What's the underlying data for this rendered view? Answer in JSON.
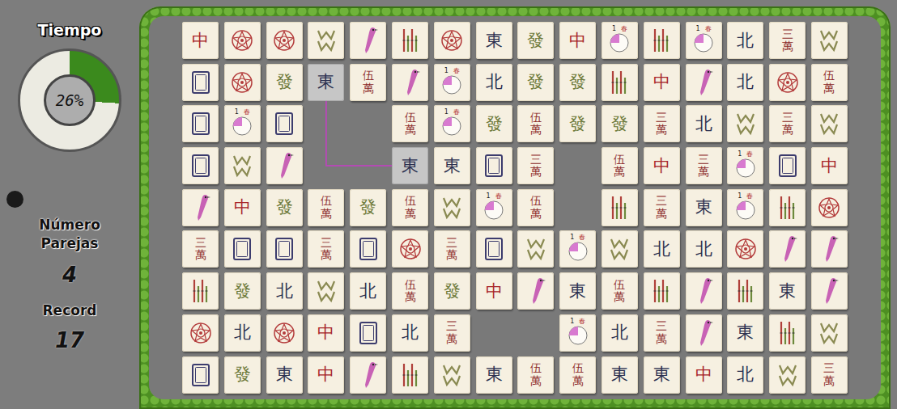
{
  "sidebar": {
    "timer": {
      "label": "Tiempo",
      "reading": "26%",
      "level": 0.26
    },
    "pairs": {
      "label": "Número Parejas",
      "value": "4"
    },
    "record": {
      "label": "Record",
      "value": "17"
    }
  },
  "board": {
    "rows": [
      [
        {
          "kind": "red",
          "text": "中",
          "selected": false
        },
        {
          "kind": "flower",
          "selected": false
        },
        {
          "kind": "flower",
          "selected": false
        },
        {
          "kind": "wm",
          "selected": false
        },
        {
          "kind": "bird",
          "selected": false
        },
        {
          "kind": "bamboo",
          "selected": false
        },
        {
          "kind": "flower",
          "selected": false
        },
        {
          "kind": "wind",
          "text": "東",
          "selected": false
        },
        {
          "kind": "green",
          "text": "發",
          "selected": false
        },
        {
          "kind": "red",
          "text": "中",
          "selected": false
        },
        {
          "kind": "season",
          "number": "1",
          "text": "春",
          "selected": false
        },
        {
          "kind": "bamboo",
          "selected": false
        },
        {
          "kind": "season",
          "number": "1",
          "text": "春",
          "selected": false
        },
        {
          "kind": "wind",
          "text": "北",
          "selected": false
        },
        {
          "kind": "wan",
          "text": "三萬",
          "selected": false
        },
        {
          "kind": "wm",
          "selected": false
        }
      ],
      [
        {
          "kind": "white",
          "selected": false
        },
        {
          "kind": "flower",
          "selected": false
        },
        {
          "kind": "green",
          "text": "發",
          "selected": false
        },
        {
          "kind": "wind",
          "text": "東",
          "selected": true
        },
        {
          "kind": "wan",
          "text": "伍萬",
          "selected": false
        },
        {
          "kind": "bird",
          "selected": false
        },
        {
          "kind": "season",
          "number": "1",
          "text": "春",
          "selected": false
        },
        {
          "kind": "wind",
          "text": "北",
          "selected": false
        },
        {
          "kind": "green",
          "text": "發",
          "selected": false
        },
        {
          "kind": "green",
          "text": "發",
          "selected": false
        },
        {
          "kind": "bamboo",
          "selected": false
        },
        {
          "kind": "red",
          "text": "中",
          "selected": false
        },
        {
          "kind": "bird",
          "selected": false
        },
        {
          "kind": "wind",
          "text": "北",
          "selected": false
        },
        {
          "kind": "flower",
          "selected": false
        },
        {
          "kind": "wan",
          "text": "伍萬",
          "selected": false
        }
      ],
      [
        {
          "kind": "white",
          "selected": false
        },
        {
          "kind": "season",
          "number": "1",
          "text": "春",
          "selected": false
        },
        {
          "kind": "white",
          "selected": false
        },
        {
          "kind": "empty",
          "selected": false
        },
        {
          "kind": "empty",
          "selected": false
        },
        {
          "kind": "wan",
          "text": "伍萬",
          "selected": false
        },
        {
          "kind": "season",
          "number": "1",
          "text": "春",
          "selected": false
        },
        {
          "kind": "green",
          "text": "發",
          "selected": false
        },
        {
          "kind": "wan",
          "text": "伍萬",
          "selected": false
        },
        {
          "kind": "green",
          "text": "發",
          "selected": false
        },
        {
          "kind": "green",
          "text": "發",
          "selected": false
        },
        {
          "kind": "wan",
          "text": "三萬",
          "selected": false
        },
        {
          "kind": "wind",
          "text": "北",
          "selected": false
        },
        {
          "kind": "wm",
          "selected": false
        },
        {
          "kind": "wan",
          "text": "三萬",
          "selected": false
        },
        {
          "kind": "wm",
          "selected": false
        }
      ],
      [
        {
          "kind": "white",
          "selected": false
        },
        {
          "kind": "wm",
          "selected": false
        },
        {
          "kind": "bird",
          "selected": false
        },
        {
          "kind": "empty",
          "selected": false
        },
        {
          "kind": "empty",
          "selected": false
        },
        {
          "kind": "wind",
          "text": "東",
          "selected": true
        },
        {
          "kind": "wind",
          "text": "東",
          "selected": false
        },
        {
          "kind": "white",
          "selected": false
        },
        {
          "kind": "wan",
          "text": "三萬",
          "selected": false
        },
        {
          "kind": "empty",
          "selected": false
        },
        {
          "kind": "wan",
          "text": "伍萬",
          "selected": false
        },
        {
          "kind": "red",
          "text": "中",
          "selected": false
        },
        {
          "kind": "wan",
          "text": "三萬",
          "selected": false
        },
        {
          "kind": "season",
          "number": "1",
          "text": "春",
          "selected": false
        },
        {
          "kind": "white",
          "selected": false
        },
        {
          "kind": "red",
          "text": "中",
          "selected": false
        }
      ],
      [
        {
          "kind": "bird",
          "selected": false
        },
        {
          "kind": "red",
          "text": "中",
          "selected": false
        },
        {
          "kind": "green",
          "text": "發",
          "selected": false
        },
        {
          "kind": "wan",
          "text": "伍萬",
          "selected": false
        },
        {
          "kind": "green",
          "text": "發",
          "selected": false
        },
        {
          "kind": "wan",
          "text": "伍萬",
          "selected": false
        },
        {
          "kind": "wm",
          "selected": false
        },
        {
          "kind": "season",
          "number": "1",
          "text": "春",
          "selected": false
        },
        {
          "kind": "wan",
          "text": "伍萬",
          "selected": false
        },
        {
          "kind": "empty",
          "selected": false
        },
        {
          "kind": "bamboo",
          "selected": false
        },
        {
          "kind": "wan",
          "text": "三萬",
          "selected": false
        },
        {
          "kind": "wind",
          "text": "東",
          "selected": false
        },
        {
          "kind": "season",
          "number": "1",
          "text": "春",
          "selected": false
        },
        {
          "kind": "bamboo",
          "selected": false
        },
        {
          "kind": "flower",
          "selected": false
        }
      ],
      [
        {
          "kind": "wan",
          "text": "三萬",
          "selected": false
        },
        {
          "kind": "white",
          "selected": false
        },
        {
          "kind": "white",
          "selected": false
        },
        {
          "kind": "wan",
          "text": "三萬",
          "selected": false
        },
        {
          "kind": "white",
          "selected": false
        },
        {
          "kind": "flower",
          "selected": false
        },
        {
          "kind": "wan",
          "text": "三萬",
          "selected": false
        },
        {
          "kind": "white",
          "selected": false
        },
        {
          "kind": "wm",
          "selected": false
        },
        {
          "kind": "season",
          "number": "1",
          "text": "春",
          "selected": false
        },
        {
          "kind": "wm",
          "selected": false
        },
        {
          "kind": "wind",
          "text": "北",
          "selected": false
        },
        {
          "kind": "wind",
          "text": "北",
          "selected": false
        },
        {
          "kind": "flower",
          "selected": false
        },
        {
          "kind": "bird",
          "selected": false
        },
        {
          "kind": "bird",
          "selected": false
        }
      ],
      [
        {
          "kind": "bamboo",
          "selected": false
        },
        {
          "kind": "green",
          "text": "發",
          "selected": false
        },
        {
          "kind": "wind",
          "text": "北",
          "selected": false
        },
        {
          "kind": "wm",
          "selected": false
        },
        {
          "kind": "wind",
          "text": "北",
          "selected": false
        },
        {
          "kind": "wan",
          "text": "伍萬",
          "selected": false
        },
        {
          "kind": "green",
          "text": "發",
          "selected": false
        },
        {
          "kind": "red",
          "text": "中",
          "selected": false
        },
        {
          "kind": "bird",
          "selected": false
        },
        {
          "kind": "wind",
          "text": "東",
          "selected": false
        },
        {
          "kind": "wan",
          "text": "伍萬",
          "selected": false
        },
        {
          "kind": "bamboo",
          "selected": false
        },
        {
          "kind": "bird",
          "selected": false
        },
        {
          "kind": "bamboo",
          "selected": false
        },
        {
          "kind": "wind",
          "text": "東",
          "selected": false
        },
        {
          "kind": "bird",
          "selected": false
        }
      ],
      [
        {
          "kind": "flower",
          "selected": false
        },
        {
          "kind": "wind",
          "text": "北",
          "selected": false
        },
        {
          "kind": "flower",
          "selected": false
        },
        {
          "kind": "red",
          "text": "中",
          "selected": false
        },
        {
          "kind": "white",
          "selected": false
        },
        {
          "kind": "wind",
          "text": "北",
          "selected": false
        },
        {
          "kind": "wan",
          "text": "三萬",
          "selected": false
        },
        {
          "kind": "empty",
          "selected": false
        },
        {
          "kind": "empty",
          "selected": false
        },
        {
          "kind": "season",
          "number": "1",
          "text": "春",
          "selected": false
        },
        {
          "kind": "wind",
          "text": "北",
          "selected": false
        },
        {
          "kind": "wan",
          "text": "三萬",
          "selected": false
        },
        {
          "kind": "bird",
          "selected": false
        },
        {
          "kind": "wind",
          "text": "東",
          "selected": false
        },
        {
          "kind": "bamboo",
          "selected": false
        },
        {
          "kind": "wm",
          "selected": false
        }
      ],
      [
        {
          "kind": "white",
          "selected": false
        },
        {
          "kind": "green",
          "text": "發",
          "selected": false
        },
        {
          "kind": "wind",
          "text": "東",
          "selected": false
        },
        {
          "kind": "red",
          "text": "中",
          "selected": false
        },
        {
          "kind": "bird",
          "selected": false
        },
        {
          "kind": "bamboo",
          "selected": false
        },
        {
          "kind": "wm",
          "selected": false
        },
        {
          "kind": "wind",
          "text": "東",
          "selected": false
        },
        {
          "kind": "wan",
          "text": "伍萬",
          "selected": false
        },
        {
          "kind": "wan",
          "text": "伍萬",
          "selected": false
        },
        {
          "kind": "wind",
          "text": "東",
          "selected": false
        },
        {
          "kind": "wind",
          "text": "東",
          "selected": false
        },
        {
          "kind": "red",
          "text": "中",
          "selected": false
        },
        {
          "kind": "wind",
          "text": "北",
          "selected": false
        },
        {
          "kind": "wm",
          "selected": false
        },
        {
          "kind": "wan",
          "text": "三萬",
          "selected": false
        }
      ]
    ],
    "link": [
      {
        "row": 1,
        "col": 3
      },
      {
        "row": 3,
        "col": 3
      },
      {
        "row": 3,
        "col": 5
      }
    ]
  }
}
